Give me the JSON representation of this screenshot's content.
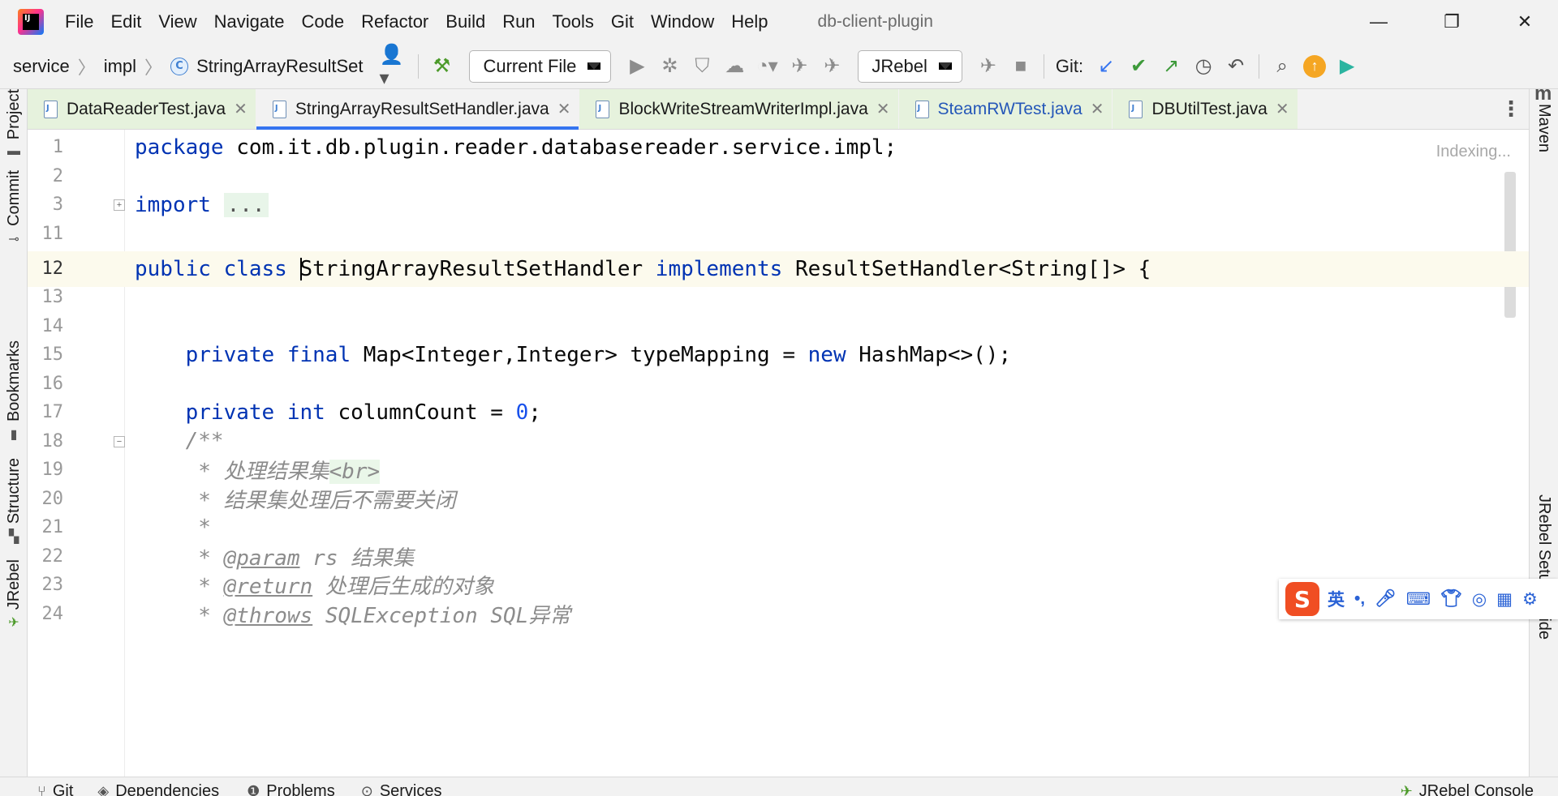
{
  "menubar": {
    "items": [
      "File",
      "Edit",
      "View",
      "Navigate",
      "Code",
      "Refactor",
      "Build",
      "Run",
      "Tools",
      "Git",
      "Window",
      "Help"
    ],
    "project_name": "db-client-plugin"
  },
  "toolbar": {
    "breadcrumbs": [
      "service",
      "impl",
      "StringArrayResultSet"
    ],
    "run_config": "Current File",
    "jrebel_config": "JRebel",
    "git_label": "Git:"
  },
  "left_stripe": {
    "tabs": [
      "Project",
      "Commit",
      "Bookmarks",
      "Structure",
      "JRebel"
    ]
  },
  "right_stripe": {
    "tabs": [
      "Maven",
      "JRebel Setup Guide"
    ]
  },
  "editor_tabs": [
    {
      "label": "DataReaderTest.java",
      "state": "normal"
    },
    {
      "label": "StringArrayResultSetHandler.java",
      "state": "active"
    },
    {
      "label": "BlockWriteStreamWriterImpl.java",
      "state": "normal"
    },
    {
      "label": "SteamRWTest.java",
      "state": "modified"
    },
    {
      "label": "DBUtilTest.java",
      "state": "normal"
    }
  ],
  "editor": {
    "status": "Indexing...",
    "line_numbers": [
      "1",
      "2",
      "3",
      "11",
      "12",
      "13",
      "14",
      "15",
      "16",
      "17",
      "18",
      "19",
      "20",
      "21",
      "22",
      "23",
      "24"
    ],
    "code": {
      "l1_kw": "package",
      "l1_rest": " com.it.db.plugin.reader.databasereader.service.impl;",
      "l3_kw": "import",
      "l3_fold": "...",
      "l12_kw": "public class ",
      "l12_name": "StringArrayResultSetHandler ",
      "l12_kw2": "implements",
      "l12_rest": " ResultSetHandler<String[]> {",
      "l15_indent": "    ",
      "l15_kw": "private final",
      "l15_mid": " Map<Integer,Integer> typeMapping = ",
      "l15_kw2": "new",
      "l15_rest": " HashMap<>();",
      "l17_kw": "private int",
      "l17_mid": " columnCount = ",
      "l17_num": "0",
      "l17_end": ";",
      "l18": "/**",
      "l19_text": " * 处理结果集",
      "l19_tag": "<br>",
      "l20": " * 结果集处理后不需要关闭",
      "l21": " *",
      "l22_pre": " * ",
      "l22_tag": "@param",
      "l22_rest": " rs 结果集",
      "l23_pre": " * ",
      "l23_tag": "@return",
      "l23_rest": " 处理后生成的对象",
      "l24_pre": " * ",
      "l24_tag": "@throws",
      "l24_rest": " SQLException SQL异常"
    }
  },
  "ime": {
    "logo": "S",
    "lang": "英"
  },
  "bottom_bar": {
    "tools": [
      "Git",
      "Dependencies",
      "Problems",
      "Services"
    ],
    "right_tool": "JRebel Console"
  },
  "colors": {
    "keyword": "#0033b3",
    "number": "#1750eb",
    "comment": "#8c8c8c",
    "tab_highlight": "#3574f0",
    "current_line": "#fcfaed"
  }
}
